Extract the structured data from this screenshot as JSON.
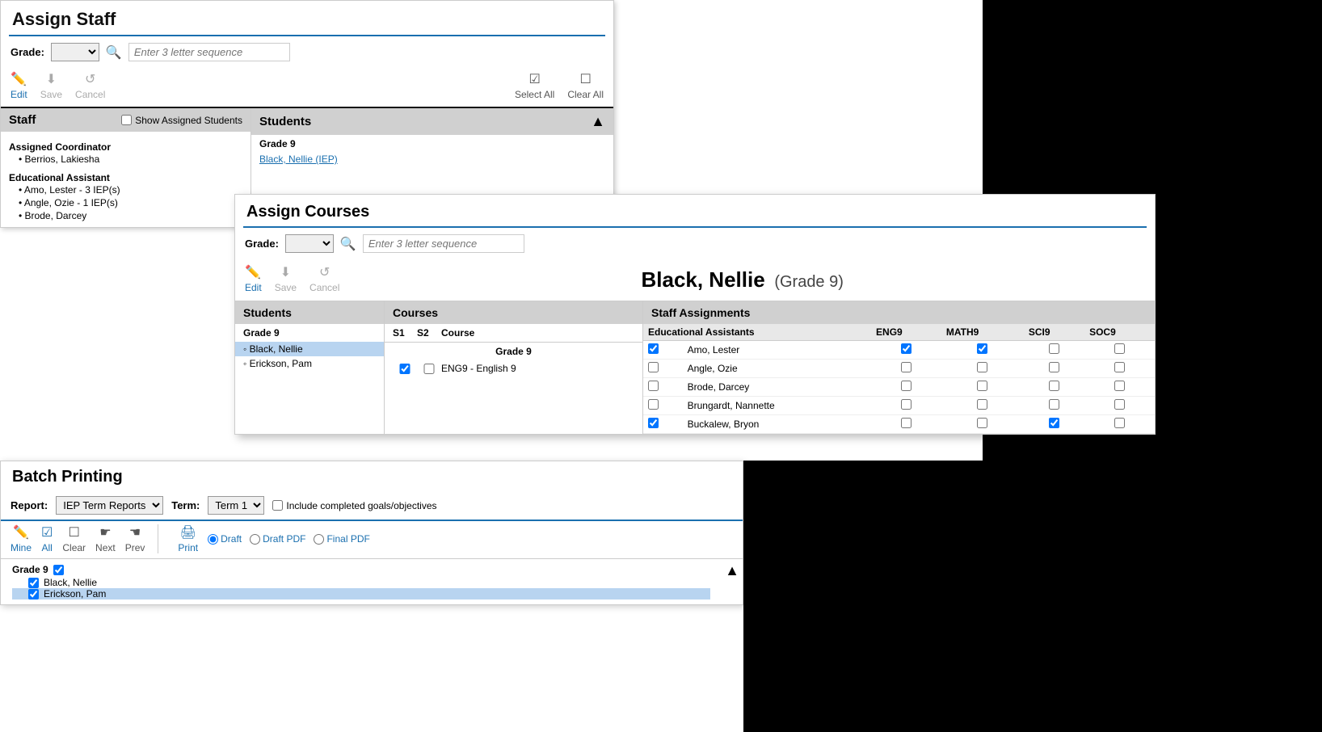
{
  "assignStaff": {
    "title": "Assign Staff",
    "filterLabel": "Grade:",
    "searchPlaceholder": "Enter 3 letter sequence",
    "toolbar": {
      "editLabel": "Edit",
      "saveLabel": "Save",
      "cancelLabel": "Cancel",
      "selectAllLabel": "Select All",
      "clearAllLabel": "Clear All"
    },
    "staff": {
      "colTitle": "Staff",
      "showAssignedLabel": "Show Assigned Students",
      "sections": [
        {
          "title": "Assigned Coordinator",
          "items": [
            "Berrios, Lakiesha"
          ]
        },
        {
          "title": "Educational Assistant",
          "items": [
            "Amo, Lester - 3 IEP(s)",
            "Angle, Ozie - 1 IEP(s)",
            "Brode, Darcey"
          ]
        }
      ]
    },
    "students": {
      "colTitle": "Students",
      "gradeLabel": "Grade 9",
      "items": [
        "Black, Nellie (IEP)"
      ]
    }
  },
  "assignCourses": {
    "title": "Assign Courses",
    "filterLabel": "Grade:",
    "searchPlaceholder": "Enter 3 letter sequence",
    "toolbar": {
      "editLabel": "Edit",
      "saveLabel": "Save",
      "cancelLabel": "Cancel"
    },
    "studentName": "Black, Nellie",
    "studentGrade": "(Grade 9)",
    "students": {
      "colTitle": "Students",
      "gradeLabel": "Grade 9",
      "items": [
        {
          "name": "Black, Nellie",
          "selected": true
        },
        {
          "name": "Erickson, Pam",
          "selected": false
        }
      ]
    },
    "courses": {
      "colTitle": "Courses",
      "headers": {
        "s1": "S1",
        "s2": "S2",
        "course": "Course"
      },
      "gradeLabel": "Grade 9",
      "rows": [
        {
          "s1": true,
          "s2": false,
          "course": "ENG9 - English 9"
        }
      ]
    },
    "staffAssignments": {
      "colTitle": "Staff Assignments",
      "subSection": "Educational Assistants",
      "courseHeaders": [
        "ENG9",
        "MATH9",
        "SCI9",
        "SOC9"
      ],
      "rows": [
        {
          "name": "Amo, Lester",
          "checked": true,
          "courses": [
            true,
            true,
            false,
            false
          ]
        },
        {
          "name": "Angle, Ozie",
          "checked": false,
          "courses": [
            false,
            false,
            false,
            false
          ]
        },
        {
          "name": "Brode, Darcey",
          "checked": false,
          "courses": [
            false,
            false,
            false,
            false
          ]
        },
        {
          "name": "Brungardt, Nannette",
          "checked": false,
          "courses": [
            false,
            false,
            false,
            false
          ]
        },
        {
          "name": "Buckalew, Bryon",
          "checked": true,
          "courses": [
            false,
            false,
            true,
            false
          ]
        }
      ]
    }
  },
  "batchPrinting": {
    "title": "Batch Printing",
    "reportLabel": "Report:",
    "reportValue": "IEP Term Reports",
    "termLabel": "Term:",
    "termValue": "Term 1",
    "includeLabel": "Include completed goals/objectives",
    "toolbar": {
      "mineLabel": "Mine",
      "allLabel": "All",
      "clearLabel": "Clear",
      "nextLabel": "Next",
      "prevLabel": "Prev",
      "printLabel": "Print"
    },
    "radioOptions": [
      "Draft",
      "Draft PDF",
      "Final PDF"
    ],
    "selectedRadio": "Draft",
    "students": {
      "gradeLabel": "Grade 9",
      "items": [
        {
          "name": "Black, Nellie",
          "checked": true,
          "selected": false
        },
        {
          "name": "Erickson, Pam",
          "checked": true,
          "selected": true
        }
      ]
    }
  },
  "icons": {
    "edit": "✏",
    "save": "↓",
    "cancel": "↺",
    "selectAll": "☑",
    "clearAll": "☐",
    "search": "🔍",
    "mine": "✏",
    "all": "☑",
    "clear": "☐",
    "next": "☛",
    "prev": "☚",
    "print": "🖨",
    "chevronUp": "▲",
    "chevronDown": "▼"
  }
}
